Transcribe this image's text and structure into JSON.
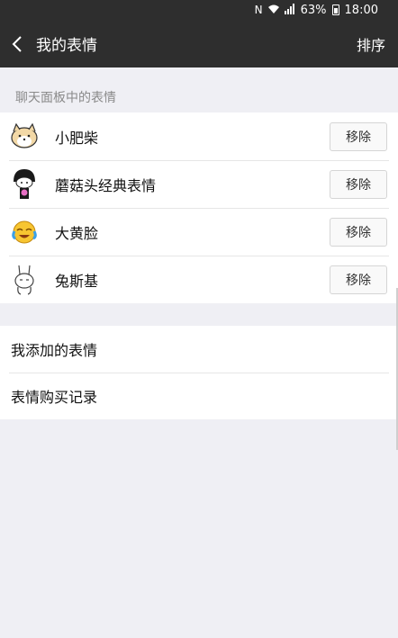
{
  "status_bar": {
    "battery": "63%",
    "time": "18:00"
  },
  "nav": {
    "title": "我的表情",
    "action": "排序"
  },
  "section_caption": "聊天面板中的表情",
  "stickers": [
    {
      "name": "小肥柴",
      "icon": "shiba-dog-icon",
      "remove_label": "移除"
    },
    {
      "name": "蘑菇头经典表情",
      "icon": "mushroom-head-icon",
      "remove_label": "移除"
    },
    {
      "name": "大黄脸",
      "icon": "yellow-face-icon",
      "remove_label": "移除"
    },
    {
      "name": "兔斯基",
      "icon": "tuzki-rabbit-icon",
      "remove_label": "移除"
    }
  ],
  "links": [
    {
      "label": "我添加的表情"
    },
    {
      "label": "表情购买记录"
    }
  ]
}
